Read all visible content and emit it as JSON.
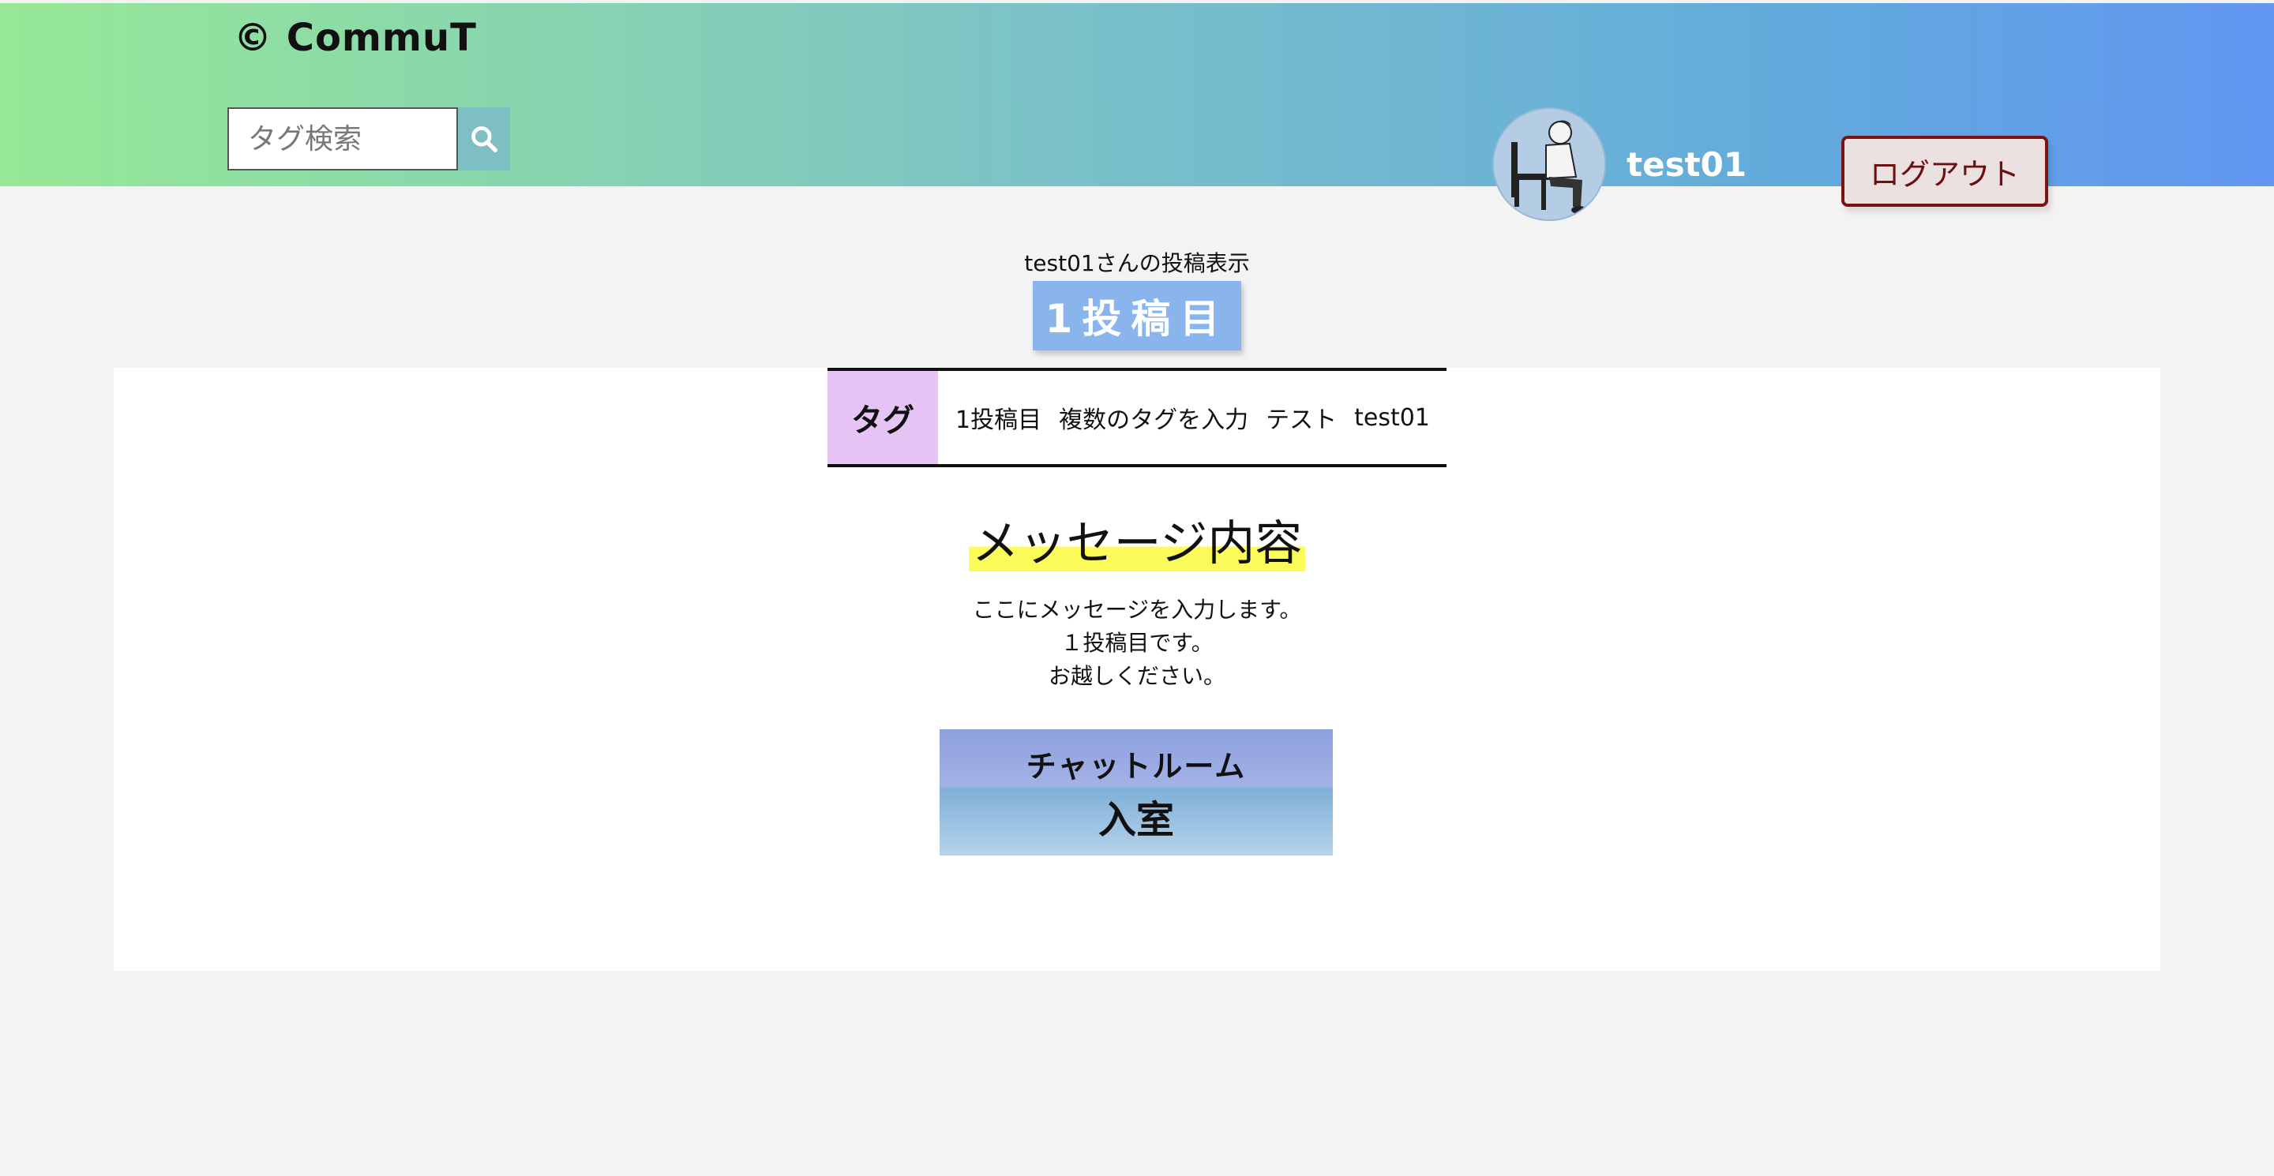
{
  "header": {
    "logo": "© CommuT",
    "search": {
      "placeholder": "タグ検索",
      "value": ""
    },
    "user": {
      "name": "test01"
    },
    "logout_label": "ログアウト"
  },
  "post": {
    "owner_caption": "test01さんの投稿表示",
    "title": "1投稿目",
    "tag_label": "タグ",
    "tags": [
      "1投稿目",
      "複数のタグを入力",
      "テスト",
      "test01"
    ],
    "message_heading": "メッセージ内容",
    "message_lines": [
      "ここにメッセージを入力します。",
      "１投稿目です。",
      "お越しください。"
    ],
    "chat_button": {
      "line1": "チャットルーム",
      "line2": "入室"
    }
  },
  "colors": {
    "header_gradient_start": "#96e896",
    "header_gradient_end": "#6196f1",
    "title_bg": "#8ab4ec",
    "tag_label_bg": "#e6c4f5",
    "highlight": "#fbfb5a",
    "logout_border": "#7a1414"
  },
  "icons": {
    "search": "search-icon",
    "avatar": "user-avatar-illustration"
  }
}
